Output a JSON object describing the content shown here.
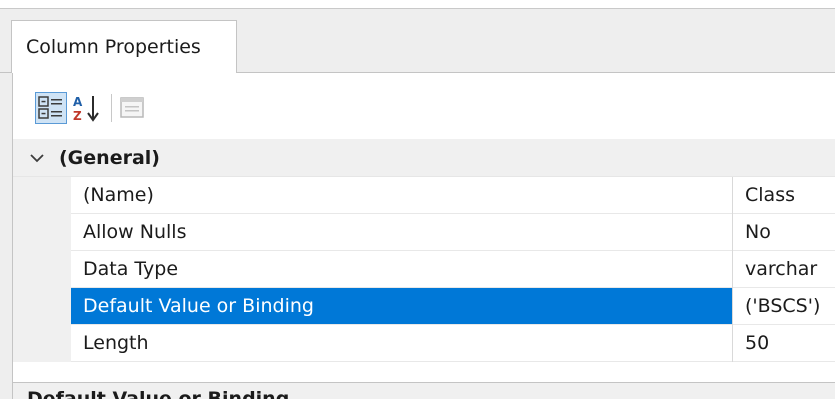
{
  "panel": {
    "tab_label": "Column Properties"
  },
  "toolbar": {
    "categorized_icon": "categorized-view-icon",
    "alphabetical_icon": "alphabetical-sort-icon",
    "property_pages_icon": "property-pages-icon"
  },
  "grid": {
    "category": {
      "label": "(General)",
      "expanded": true
    },
    "rows": [
      {
        "name": "(Name)",
        "value": "Class"
      },
      {
        "name": "Allow Nulls",
        "value": "No"
      },
      {
        "name": "Data Type",
        "value": "varchar"
      },
      {
        "name": "Default Value or Binding",
        "value": "('BSCS')",
        "selected": true
      },
      {
        "name": "Length",
        "value": "50"
      }
    ]
  },
  "description": {
    "title": "Default Value or Binding"
  },
  "colors": {
    "selection": "#0078d7",
    "panel_bg": "#eeeeee",
    "gutter_bg": "#f0f0f0"
  }
}
